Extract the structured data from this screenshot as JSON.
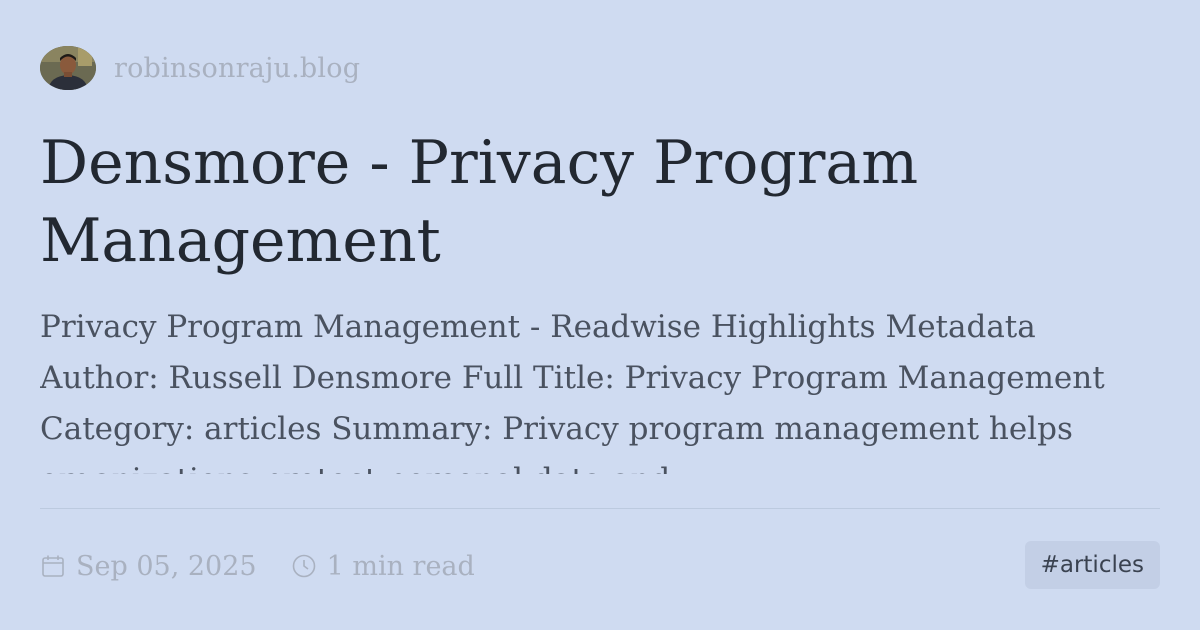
{
  "site": {
    "name": "robinsonraju.blog",
    "avatar_icon": "author-avatar"
  },
  "post": {
    "title": "Densmore - Privacy Program Management",
    "summary": "Privacy Program Management - Readwise Highlights Metadata Author: Russell Densmore Full Title: Privacy Program Management Category: articles Summary: Privacy program management helps organizations protect personal data and"
  },
  "meta": {
    "date": "Sep 05, 2025",
    "date_icon": "calendar-icon",
    "read_time": "1 min read",
    "read_time_icon": "clock-icon"
  },
  "tags": {
    "primary": "#articles"
  },
  "colors": {
    "background": "#cfdbf1",
    "title": "#222831",
    "summary": "#4a5260",
    "muted": "#a9b1c0",
    "tag_bg": "#c3cfe6"
  }
}
